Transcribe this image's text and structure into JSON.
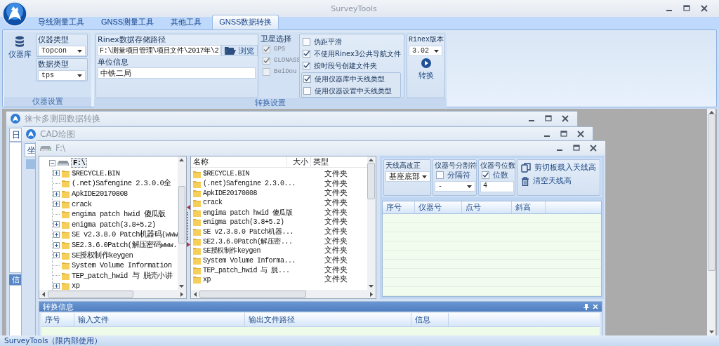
{
  "window": {
    "title": "SurveyTools"
  },
  "tabs": [
    {
      "label": "导线测量工具",
      "selected": false
    },
    {
      "label": "GNSS测量工具",
      "selected": false
    },
    {
      "label": "其他工具",
      "selected": false
    },
    {
      "label": "GNSS数据转换",
      "selected": true
    }
  ],
  "instrument_group": {
    "caption": "仪器设置",
    "library_button": "仪器库",
    "instrument_type": {
      "label": "仪器类型",
      "value": "Topcon"
    },
    "data_type": {
      "label": "数据类型",
      "value": "tps"
    }
  },
  "conversion_group": {
    "caption": "转换设置",
    "rinex_path": {
      "label": "Rinex数据存储路径",
      "value": "F:\\测量项目管理\\项目文件\\2017年\\2",
      "browse_button": "浏览"
    },
    "unit_info": {
      "label": "单位信息",
      "value": "中铁二局"
    },
    "satellites": {
      "label": "卫星选择",
      "items": [
        {
          "label": "GPS",
          "checked": true,
          "disabled": true
        },
        {
          "label": "GLONASS",
          "checked": true,
          "disabled": true
        },
        {
          "label": "BeiDou",
          "checked": false,
          "disabled": true
        }
      ]
    },
    "options": [
      {
        "label": "伪距平滑",
        "checked": false
      },
      {
        "label": "不使用Rinex3公共导航文件",
        "checked": true
      },
      {
        "label": "按时段号创建文件夹",
        "checked": true
      }
    ],
    "antenna_options": [
      {
        "label": "使用仪器库中天线类型",
        "checked": true
      },
      {
        "label": "使用仪器设置中天线类型",
        "checked": false
      }
    ],
    "rinex_version": {
      "label": "Rinex版本",
      "value": "3.02"
    },
    "convert_button": "转换"
  },
  "child_windows": [
    {
      "title": "徕卡多测回数据转换",
      "tab": "日",
      "panel": "信"
    },
    {
      "title": "CAD绘图",
      "tab": "坐"
    }
  ],
  "file_window": {
    "title": "F:\\",
    "tree": {
      "root": {
        "label": "F:\\",
        "has_children": true,
        "expanded": true,
        "children": [
          {
            "label": "$RECYCLE.BIN",
            "has_children": true
          },
          {
            "label": "(.net)Safengine 2.3.0.0全",
            "has_children": false
          },
          {
            "label": "ApkIDE20170808",
            "has_children": true
          },
          {
            "label": "crack",
            "has_children": true
          },
          {
            "label": "engima patch hwid 傻瓜版",
            "has_children": false
          },
          {
            "label": "enigma patch(3.8+5.2)",
            "has_children": true
          },
          {
            "label": "SE v2.3.8.0 Patch机器码(www",
            "has_children": true
          },
          {
            "label": "SE2.3.6.0Patch(解压密码www.",
            "has_children": true
          },
          {
            "label": "SE授权制作keygen",
            "has_children": true
          },
          {
            "label": "System Volume Information",
            "has_children": false
          },
          {
            "label": "TEP_patch_hwid 与 脱壳小讲",
            "has_children": false
          },
          {
            "label": "xp",
            "has_children": true
          }
        ]
      }
    },
    "file_list": {
      "columns": [
        "名称",
        "大小",
        "类型"
      ],
      "rows": [
        {
          "name": "$RECYCLE.BIN",
          "type": "文件夹"
        },
        {
          "name": "(.net)Safengine 2.3.0...",
          "type": "文件夹"
        },
        {
          "name": "ApkIDE20170808",
          "type": "文件夹"
        },
        {
          "name": "crack",
          "type": "文件夹"
        },
        {
          "name": "engima patch hwid 傻瓜版",
          "type": "文件夹"
        },
        {
          "name": "enigma patch(3.8+5.2)",
          "type": "文件夹"
        },
        {
          "name": "SE v2.3.8.0 Patch机器...",
          "type": "文件夹"
        },
        {
          "name": "SE2.3.6.0Patch(解压密...",
          "type": "文件夹"
        },
        {
          "name": "SE授权制作keygen",
          "type": "文件夹"
        },
        {
          "name": "System Volume Informa...",
          "type": "文件夹"
        },
        {
          "name": "TEP_patch_hwid 与 脱...",
          "type": "文件夹"
        },
        {
          "name": "xp",
          "type": "文件夹"
        }
      ]
    },
    "antenna": {
      "correction": {
        "label": "天线高改正",
        "value": "基座底部"
      },
      "separator": {
        "label": "仪器号分割符",
        "checkbox": {
          "label": "分隔符",
          "checked": false
        },
        "value": "-"
      },
      "digits": {
        "label": "仪器号位数",
        "checkbox": {
          "label": "位数",
          "checked": true
        },
        "value": "4"
      },
      "paste_button": "剪切板载入天线高",
      "clear_button": "清空天线高"
    },
    "grid": {
      "columns": [
        "序号",
        "仪器号",
        "点号",
        "斜高"
      ]
    },
    "info_panel": {
      "title": "转换信息",
      "columns": [
        "序号",
        "输入文件",
        "输出文件路径",
        "信息"
      ]
    }
  },
  "status_bar": {
    "text": "SurveyTools（限内部使用）"
  }
}
